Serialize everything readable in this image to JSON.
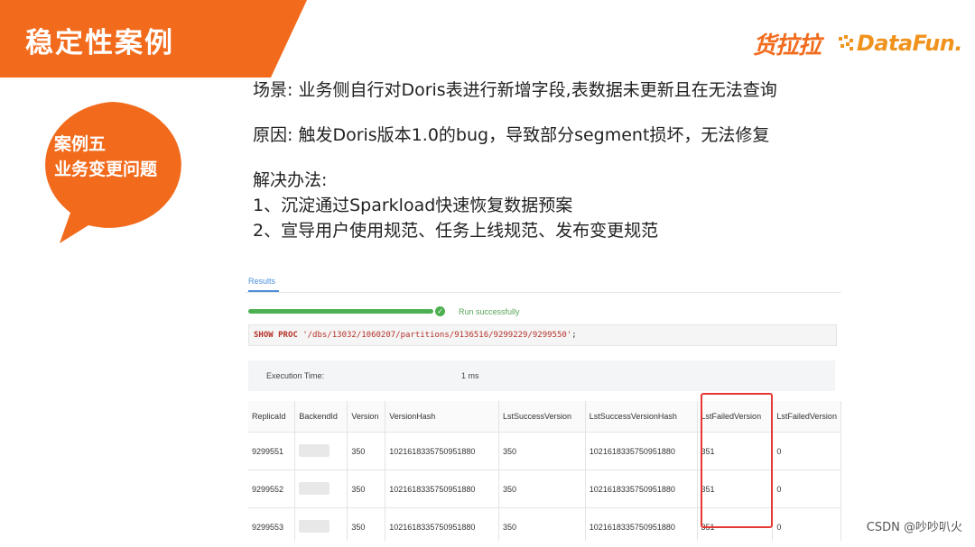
{
  "slide": {
    "title": "稳定性案例",
    "bubble_line1": "案例五",
    "bubble_line2": "业务变更问题",
    "logos": {
      "huolala": "货拉拉",
      "datafun": "DataFun."
    },
    "colors": {
      "orange": "#f26b1d",
      "logo_orange": "#f0931e"
    }
  },
  "content": {
    "scene": "场景: 业务侧自行对Doris表进行新增字段,表数据未更新且在无法查询",
    "cause": "原因: 触发Doris版本1.0的bug，导致部分segment损坏，无法修复",
    "solution_title": "解决办法:",
    "solution_1": "1、沉淀通过Sparkload快速恢复数据预案",
    "solution_2": "2、宣导用户使用规范、任务上线规范、发布变更规范"
  },
  "screenshot": {
    "tab": "Results",
    "status": "Run successfully",
    "sql": {
      "kw1": "SHOW",
      "kw2": "PROC",
      "path": "'/dbs/13032/1060207/partitions/9136516/9299229/9299550'",
      "end": ";"
    },
    "exec_label": "Execution Time:",
    "exec_value": "1 ms",
    "columns": [
      "ReplicaId",
      "BackendId",
      "Version",
      "VersionHash",
      "LstSuccessVersion",
      "LstSuccessVersionHash",
      "LstFailedVersion",
      "LstFailedVersion"
    ],
    "rows": [
      [
        "9299551",
        "350",
        "1021618335750951880",
        "350",
        "1021618335750951880",
        "351",
        "0"
      ],
      [
        "9299552",
        "350",
        "1021618335750951880",
        "350",
        "1021618335750951880",
        "351",
        "0"
      ],
      [
        "9299553",
        "350",
        "1021618335750951880",
        "350",
        "1021618335750951880",
        "351",
        "0"
      ]
    ]
  },
  "watermark": "CSDN @吵吵叭火"
}
